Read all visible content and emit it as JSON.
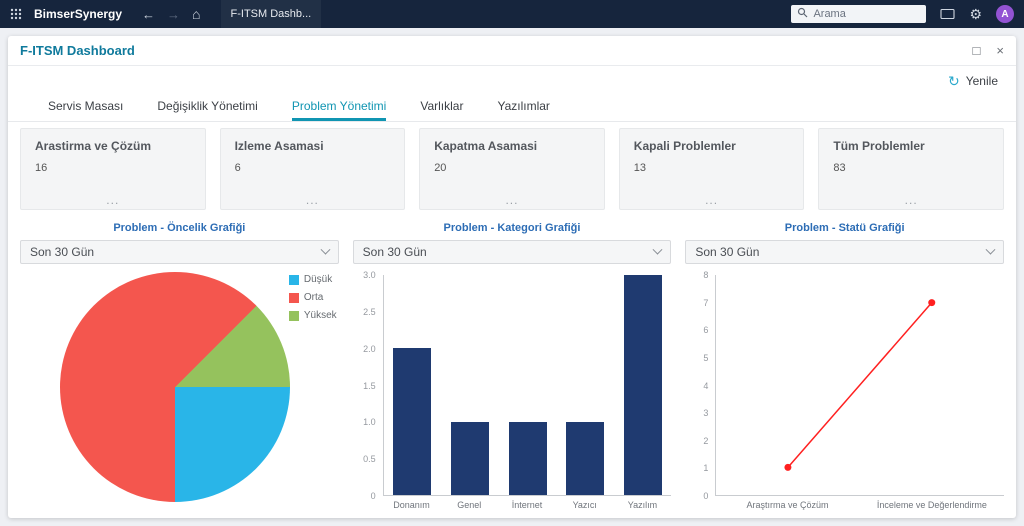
{
  "topbar": {
    "brand": "BimserSynergy",
    "nav_tab": "F-ITSM Dashb...",
    "search_placeholder": "Arama",
    "avatar_initial": "A"
  },
  "icons": {
    "back": "←",
    "forward": "→",
    "home": "⌂",
    "gear": "⚙",
    "maximize": "□",
    "close": "×",
    "refresh": "↻"
  },
  "window": {
    "title": "F-ITSM Dashboard",
    "refresh_label": "Yenile"
  },
  "tabs": [
    {
      "label": "Servis Masası"
    },
    {
      "label": "Değişiklik Yönetimi"
    },
    {
      "label": "Problem Yönetimi"
    },
    {
      "label": "Varlıklar"
    },
    {
      "label": "Yazılımlar"
    }
  ],
  "active_tab": "Problem Yönetimi",
  "cards": [
    {
      "title": "Arastirma ve Çözüm",
      "value": "16",
      "more": "..."
    },
    {
      "title": "Izleme Asamasi",
      "value": "6",
      "more": "..."
    },
    {
      "title": "Kapatma Asamasi",
      "value": "20",
      "more": "..."
    },
    {
      "title": "Kapali Problemler",
      "value": "13",
      "more": "..."
    },
    {
      "title": "Tüm Problemler",
      "value": "83",
      "more": "..."
    }
  ],
  "chart_data": [
    {
      "type": "pie",
      "title": "Problem - Öncelik Grafiği",
      "filter": "Son 30 Gün",
      "labels": [
        "Düşük",
        "Orta",
        "Yüksek"
      ],
      "values": [
        2,
        5,
        1
      ],
      "colors": [
        "#29B5E8",
        "#F4564E",
        "#95C25D"
      ],
      "start_angle": 45,
      "draw_order": [
        2,
        0,
        1
      ],
      "legend_position": "right"
    },
    {
      "type": "bar",
      "title": "Problem - Kategori Grafiği",
      "filter": "Son 30 Gün",
      "categories": [
        "Donanım",
        "Genel",
        "İnternet",
        "Yazıcı",
        "Yazılım"
      ],
      "values": [
        2,
        1,
        1,
        1,
        3
      ],
      "ylim": [
        0,
        3
      ],
      "ytick_step": 0.5,
      "bar_color": "#1F3A70",
      "grid": false
    },
    {
      "type": "line",
      "title": "Problem - Statü Grafiği",
      "filter": "Son 30 Gün",
      "categories": [
        "Araştırma ve Çözüm",
        "İnceleme ve Değerlendirme"
      ],
      "values": [
        1,
        7
      ],
      "ylim": [
        0,
        8
      ],
      "ytick_step": 1,
      "line_color": "#FF2020",
      "grid": false
    }
  ],
  "colors": {
    "topbar_bg": "#16253D",
    "accent_teal": "#1095B2",
    "window_title_teal": "#0F7A9C",
    "chart_title_blue": "#2D6DB5",
    "avatar_purple": "#9353D3"
  }
}
